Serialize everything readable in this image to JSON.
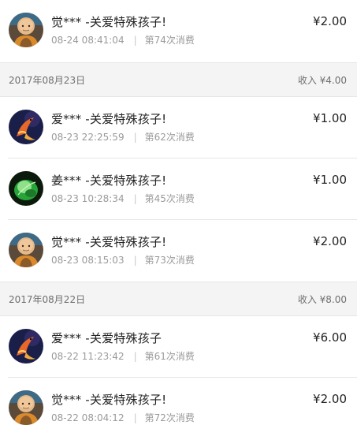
{
  "items": [
    {
      "avatar": "monk-avatar",
      "name": "觉***",
      "title_suffix": " -关爱特殊孩子!",
      "time": "08-24 08:41:04",
      "count": "第74次消费",
      "amount": "¥2.00"
    },
    {
      "avatar": "koi-avatar",
      "name": "爱***",
      "title_suffix": " -关爱特殊孩子!",
      "time": "08-23 22:25:59",
      "count": "第62次消费",
      "amount": "¥1.00"
    },
    {
      "avatar": "leaf-avatar",
      "name": "姜***",
      "title_suffix": " -关爱特殊孩子!",
      "time": "08-23 10:28:34",
      "count": "第45次消费",
      "amount": "¥1.00"
    },
    {
      "avatar": "monk-avatar",
      "name": "觉***",
      "title_suffix": " -关爱特殊孩子!",
      "time": "08-23 08:15:03",
      "count": "第73次消费",
      "amount": "¥2.00"
    },
    {
      "avatar": "koi-avatar",
      "name": "爱***",
      "title_suffix": " -关爱特殊孩子",
      "time": "08-22 11:23:42",
      "count": "第61次消费",
      "amount": "¥6.00"
    },
    {
      "avatar": "monk-avatar",
      "name": "觉***",
      "title_suffix": " -关爱特殊孩子!",
      "time": "08-22 08:04:12",
      "count": "第72次消费",
      "amount": "¥2.00"
    }
  ],
  "day_groups": [
    {
      "date": "2017年08月23日",
      "total": "收入 ¥4.00"
    },
    {
      "date": "2017年08月22日",
      "total": "收入 ¥8.00"
    }
  ],
  "separator": "|"
}
